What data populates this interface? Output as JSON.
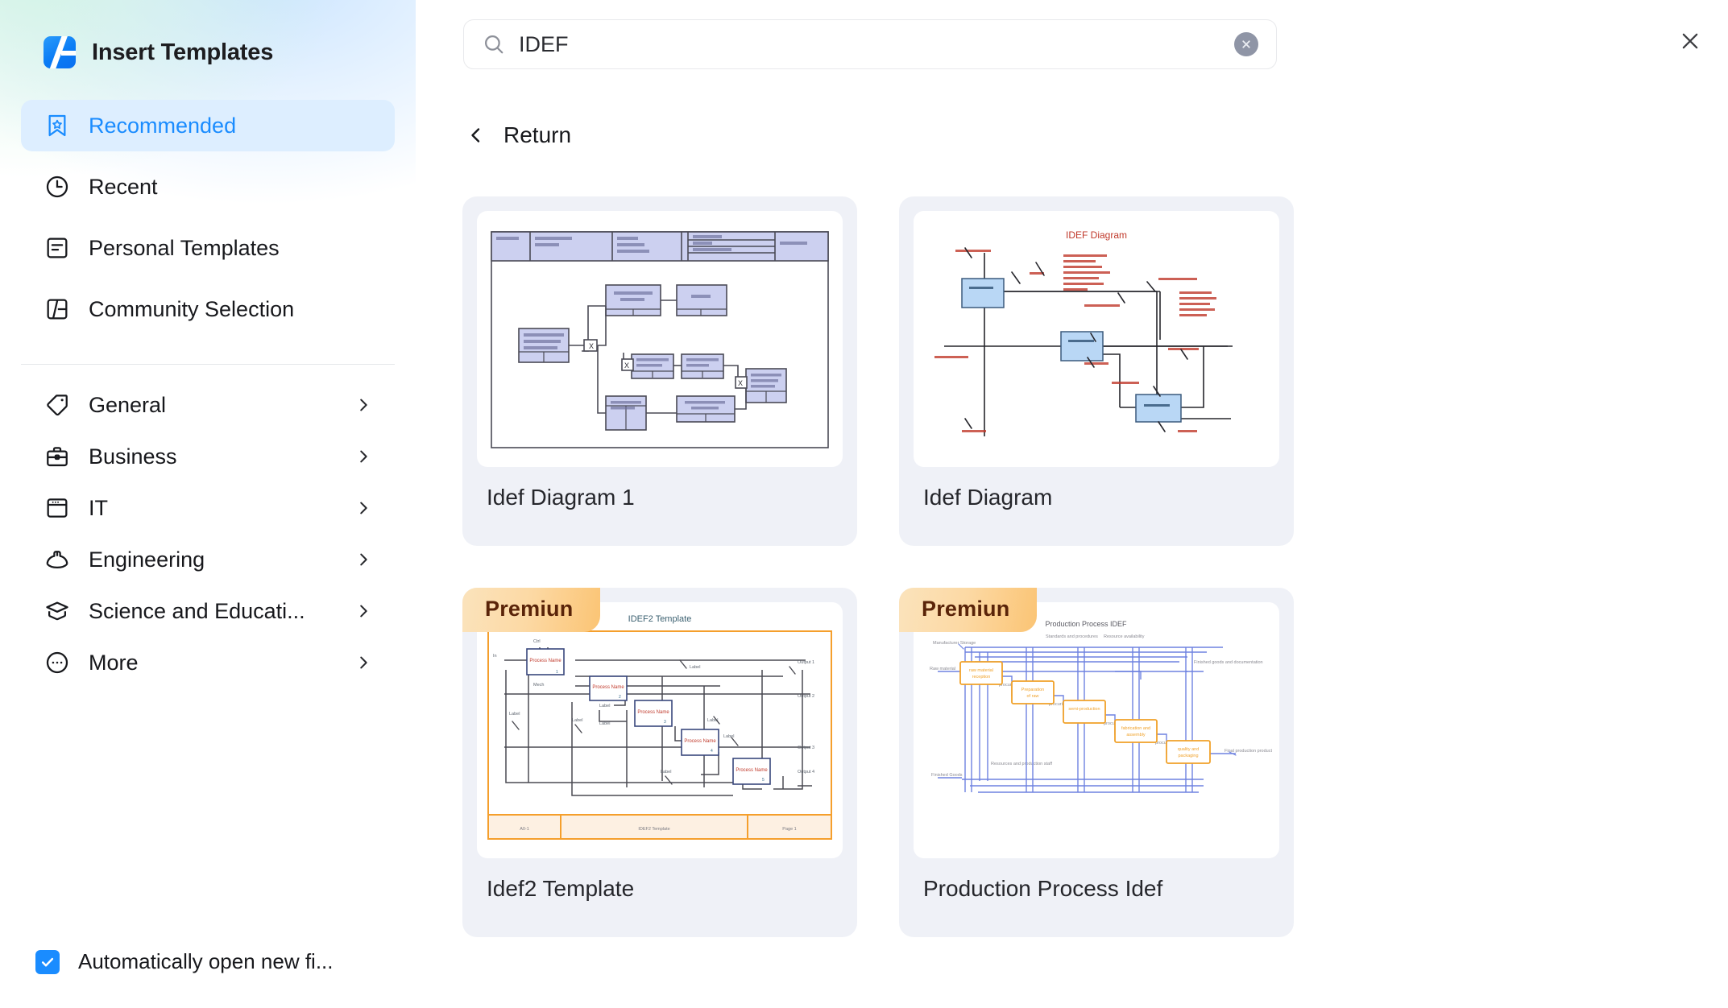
{
  "app": {
    "title": "Insert Templates",
    "logo_icon": "templates-logo-icon"
  },
  "search": {
    "value": "IDEF",
    "placeholder": "Search templates",
    "icon": "search-icon",
    "clear_icon": "clear-circle-icon"
  },
  "close_icon": "close-icon",
  "return": {
    "label": "Return",
    "icon": "chevron-left-icon"
  },
  "sidebar": {
    "primary": [
      {
        "label": "Recommended",
        "icon": "bookmark-star-icon",
        "active": true
      },
      {
        "label": "Recent",
        "icon": "clock-icon",
        "active": false
      },
      {
        "label": "Personal Templates",
        "icon": "document-lines-icon",
        "active": false
      },
      {
        "label": "Community Selection",
        "icon": "community-grid-icon",
        "active": false
      }
    ],
    "categories": [
      {
        "label": "General",
        "icon": "tag-icon",
        "chevron": "chevron-right-icon"
      },
      {
        "label": "Business",
        "icon": "briefcase-icon",
        "chevron": "chevron-right-icon"
      },
      {
        "label": "IT",
        "icon": "window-icon",
        "chevron": "chevron-right-icon"
      },
      {
        "label": "Engineering",
        "icon": "hard-hat-icon",
        "chevron": "chevron-right-icon"
      },
      {
        "label": "Science and Educati...",
        "icon": "graduation-cap-icon",
        "chevron": "chevron-right-icon"
      },
      {
        "label": "More",
        "icon": "ellipsis-circle-icon",
        "chevron": "chevron-right-icon"
      }
    ],
    "auto_open": {
      "label": "Automatically open new fi...",
      "checked": true
    }
  },
  "templates": [
    {
      "title": "Idef Diagram 1",
      "badge": null,
      "thumbnail_style": "idef0-lavender-boxes"
    },
    {
      "title": "Idef Diagram",
      "badge": null,
      "thumbnail_title": "IDEF Diagram",
      "thumbnail_style": "idef-blue-boxes-red-labels"
    },
    {
      "title": "Idef2 Template",
      "badge": "Premiun",
      "thumbnail_title": "IDEF2 Template",
      "thumbnail_style": "idef2-orange-frame"
    },
    {
      "title": "Production Process Idef",
      "badge": "Premiun",
      "thumbnail_title": "Production Process IDEF",
      "thumbnail_style": "production-staircase-blue-orange"
    }
  ],
  "colors": {
    "accent": "#1a8cff",
    "accent_soft": "#ddeeff",
    "card_bg": "#eff1f7",
    "badge_text": "#5a2409",
    "badge_from": "#fbe3bc",
    "badge_to": "#fbc474",
    "text": "#17181c"
  }
}
